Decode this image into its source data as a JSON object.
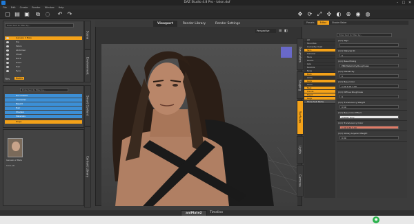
{
  "window": {
    "title": "DAZ Studio 4.8 Pro - talon.duf",
    "min": "–",
    "max": "□",
    "close": "✕"
  },
  "menu": [
    "File",
    "Edit",
    "Create",
    "Render",
    "Window",
    "Help"
  ],
  "left_top": {
    "search_placeholder": "Enter text to filter by...",
    "rows": [
      "Genesis 2 Male",
      "Hip",
      "Pelvis",
      "Abdomen",
      "Chest",
      "Neck",
      "Head",
      "Hair",
      "Eyes"
    ],
    "tabs": [
      "Files",
      "Nodes"
    ],
    "side_tabs": [
      "Scene",
      "Environment"
    ]
  },
  "left_mid": {
    "search_placeholder": "Enter text to filter by...",
    "rows": [
      "Documents",
      "Character",
      "Export",
      "Hair",
      "Shaders",
      "Materials",
      "Props"
    ],
    "side_tabs": [
      "Smart Content",
      "Content Library"
    ]
  },
  "left_bottom": {
    "items": [
      {
        "label": "Genesis 2 Male"
      },
      {
        "label": "Genesis 2 Male",
        "sub": "MATLAB"
      }
    ]
  },
  "viewport": {
    "tabs": [
      "Viewport",
      "Render Library",
      "Render Settings"
    ],
    "camera": "Perspective"
  },
  "right": {
    "tabs": [
      "Presets",
      "Editor",
      "Shader Baker"
    ],
    "active_tab": "Editor",
    "search_placeholder": "Enter text to filter by...",
    "surfaces": [
      "All",
      "Favorites",
      "Currently Used",
      "Skin",
      "General",
      "Face",
      "Mouth",
      "Lips",
      "Nostrils",
      "Eyes",
      "Ears",
      "Arms",
      "Legs",
      "Torso",
      "Feet",
      "Hands",
      "Head",
      "Legs",
      "Show Sub Items"
    ],
    "properties": [
      {
        "label": "(1/1) Tags",
        "value": ""
      },
      {
        "label": "(1/1) Material ID",
        "value": "0"
      },
      {
        "label": "(1/1) Base Mixing",
        "value": "PBR Metallicity/Roughness"
      },
      {
        "label": "(1/1) Metallicity",
        "value": "0"
      },
      {
        "label": "(1/1) Base Color",
        "value": "1.00    1.00    1.00"
      },
      {
        "label": "(1/1) Diffuse Roughness",
        "value": "0"
      },
      {
        "label": "(1/1) Translucency Weight",
        "value": "0.50"
      },
      {
        "label": "(1/1) Base Color Effect",
        "value": "Scatter Only"
      },
      {
        "label": "(1/1) Translucency Color",
        "value": "1.00    0.69    0.60"
      },
      {
        "label": "(1/1) Glossy Layered Weight",
        "value": "0.30"
      }
    ],
    "side_tabs": [
      "Parameters",
      "Shaping",
      "Surfaces",
      "Lights",
      "Cameras"
    ]
  },
  "bottom": {
    "tabs": [
      "aniMate2",
      "Timeline"
    ],
    "active": "aniMate2"
  },
  "colors": {
    "accent": "#f4a219",
    "select_blue": "#3c8fd6",
    "bg": "#3c3c3c"
  },
  "icons": [
    "daz-logo-icon",
    "new-scene-icon",
    "open-file-icon",
    "save-icon",
    "undo-icon",
    "redo-icon",
    "node-select-icon",
    "universal-tool-icon",
    "render-icon",
    "app-icon"
  ]
}
